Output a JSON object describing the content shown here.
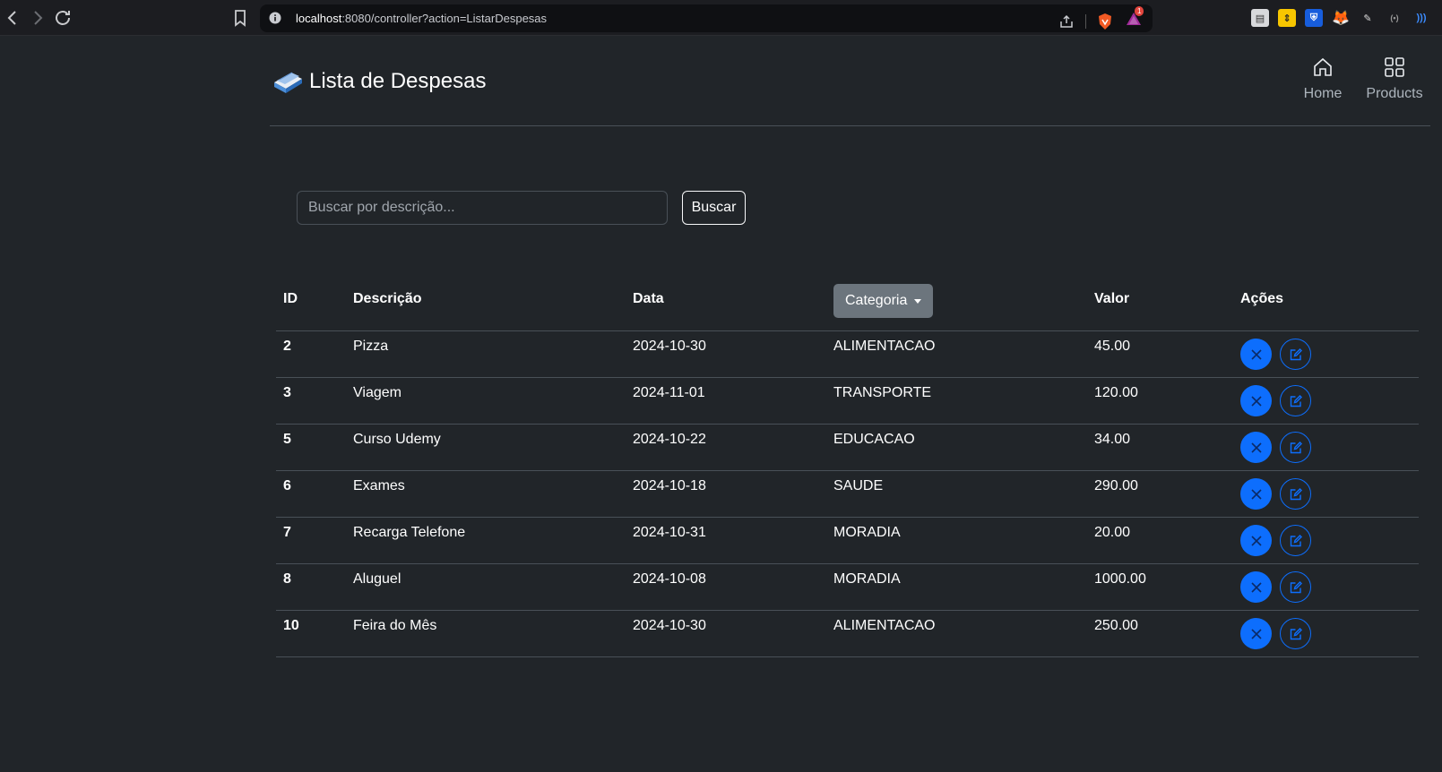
{
  "browser": {
    "url_host": "localhost",
    "url_rest": ":8080/controller?action=ListarDespesas",
    "notification_count": "1"
  },
  "header": {
    "title": "Lista de Despesas",
    "nav": [
      {
        "label": "Home",
        "icon": "home-icon"
      },
      {
        "label": "Products",
        "icon": "grid-icon"
      }
    ]
  },
  "search": {
    "placeholder": "Buscar por descrição...",
    "value": "",
    "button_label": "Buscar"
  },
  "table": {
    "columns": {
      "id": "ID",
      "descricao": "Descrição",
      "data": "Data",
      "categoria": "Categoria",
      "valor": "Valor",
      "acoes": "Ações"
    },
    "rows": [
      {
        "id": "2",
        "descricao": "Pizza",
        "data": "2024-10-30",
        "categoria": "ALIMENTACAO",
        "valor": "45.00"
      },
      {
        "id": "3",
        "descricao": "Viagem",
        "data": "2024-11-01",
        "categoria": "TRANSPORTE",
        "valor": "120.00"
      },
      {
        "id": "5",
        "descricao": "Curso Udemy",
        "data": "2024-10-22",
        "categoria": "EDUCACAO",
        "valor": "34.00"
      },
      {
        "id": "6",
        "descricao": "Exames",
        "data": "2024-10-18",
        "categoria": "SAUDE",
        "valor": "290.00"
      },
      {
        "id": "7",
        "descricao": "Recarga Telefone",
        "data": "2024-10-31",
        "categoria": "MORADIA",
        "valor": "20.00"
      },
      {
        "id": "8",
        "descricao": "Aluguel",
        "data": "2024-10-08",
        "categoria": "MORADIA",
        "valor": "1000.00"
      },
      {
        "id": "10",
        "descricao": "Feira do Mês",
        "data": "2024-10-30",
        "categoria": "ALIMENTACAO",
        "valor": "250.00"
      }
    ]
  },
  "colors": {
    "background": "#212529",
    "primary": "#0d6efd",
    "secondary": "#6c757d",
    "muted_text": "#adb5bd"
  }
}
